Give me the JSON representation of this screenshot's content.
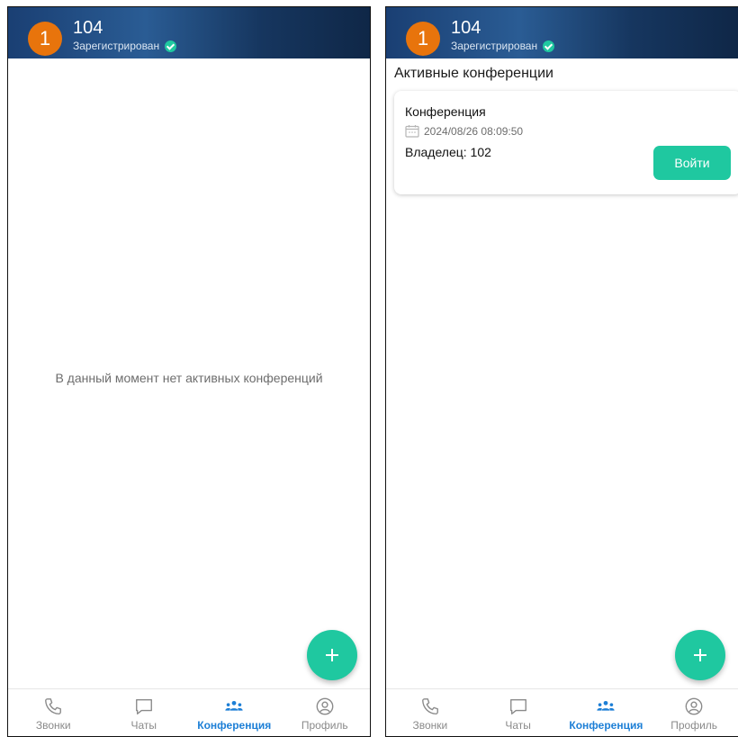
{
  "screens": [
    {
      "header": {
        "avatar_text": "1",
        "extension": "104",
        "status": "Зарегистрирован"
      },
      "empty_message": "В данный момент нет активных конференций",
      "nav": [
        {
          "label": "Звонки",
          "icon": "phone-icon",
          "active": false
        },
        {
          "label": "Чаты",
          "icon": "chat-icon",
          "active": false
        },
        {
          "label": "Конференция",
          "icon": "conference-icon",
          "active": true
        },
        {
          "label": "Профиль",
          "icon": "profile-icon",
          "active": false
        }
      ]
    },
    {
      "header": {
        "avatar_text": "1",
        "extension": "104",
        "status": "Зарегистрирован"
      },
      "section_title": "Активные конференции",
      "conferences": [
        {
          "name": "Конференция",
          "date": "2024/08/26 08:09:50",
          "owner": "Владелец: 102",
          "join_label": "Войти"
        }
      ],
      "nav": [
        {
          "label": "Звонки",
          "icon": "phone-icon",
          "active": false
        },
        {
          "label": "Чаты",
          "icon": "chat-icon",
          "active": false
        },
        {
          "label": "Конференция",
          "icon": "conference-icon",
          "active": true
        },
        {
          "label": "Профиль",
          "icon": "profile-icon",
          "active": false
        }
      ]
    }
  ],
  "colors": {
    "accent": "#1fc8a0",
    "avatar": "#e8740c",
    "nav_active": "#1d7fd6",
    "header": "#1a3f73"
  }
}
